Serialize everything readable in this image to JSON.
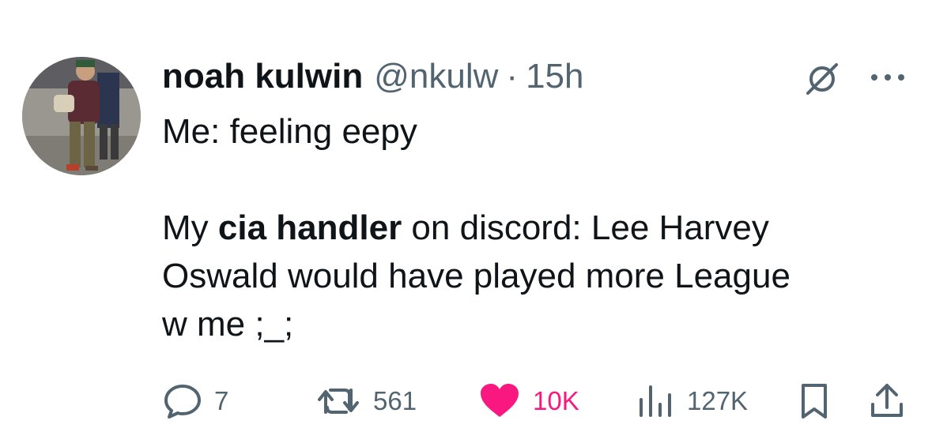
{
  "tweet": {
    "author": {
      "display_name": "noah kulwin",
      "handle": "@nkulw",
      "avatar_icon": "profile-photo"
    },
    "separator": "·",
    "timestamp": "15h",
    "text": {
      "line1": "Me: feeling eepy",
      "line2_prefix": "My ",
      "line2_bold": "cia handler",
      "line2_suffix": " on discord: Lee Harvey",
      "line3": "Oswald would have played more League",
      "line4": "w me ;_;"
    },
    "actions": {
      "replies": "7",
      "reposts": "561",
      "likes": "10K",
      "views": "127K"
    },
    "icons": {
      "grok": "grok-icon",
      "more": "more-icon",
      "reply": "reply-icon",
      "repost": "repost-icon",
      "like": "heart-icon",
      "views": "views-icon",
      "bookmark": "bookmark-icon",
      "share": "share-icon"
    },
    "colors": {
      "text": "#0f1419",
      "secondary": "#536471",
      "like": "#f91880"
    }
  }
}
